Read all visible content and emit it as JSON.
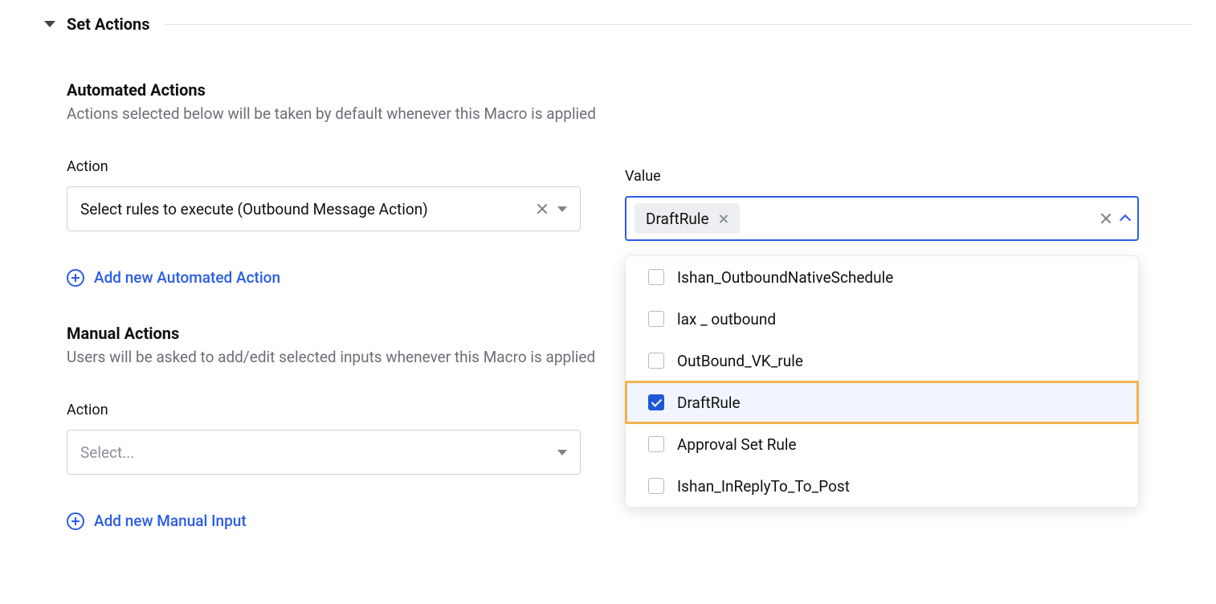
{
  "section_title": "Set Actions",
  "automated": {
    "title": "Automated Actions",
    "desc": "Actions selected below will be taken by default whenever this Macro is applied",
    "action_label": "Action",
    "value_label": "Value",
    "action_selected": "Select rules to execute (Outbound Message Action)",
    "value_chip": "DraftRule",
    "add_label": "Add new Automated Action",
    "options": [
      {
        "label": "Ishan_OutboundNativeSchedule",
        "checked": false
      },
      {
        "label": "lax _ outbound",
        "checked": false
      },
      {
        "label": "OutBound_VK_rule",
        "checked": false
      },
      {
        "label": "DraftRule",
        "checked": true
      },
      {
        "label": "Approval Set Rule",
        "checked": false
      },
      {
        "label": "Ishan_InReplyTo_To_Post",
        "checked": false
      }
    ]
  },
  "manual": {
    "title": "Manual Actions",
    "desc": "Users will be asked to add/edit selected inputs whenever this Macro is applied",
    "action_label": "Action",
    "placeholder": "Select...",
    "add_label": "Add new Manual Input"
  }
}
